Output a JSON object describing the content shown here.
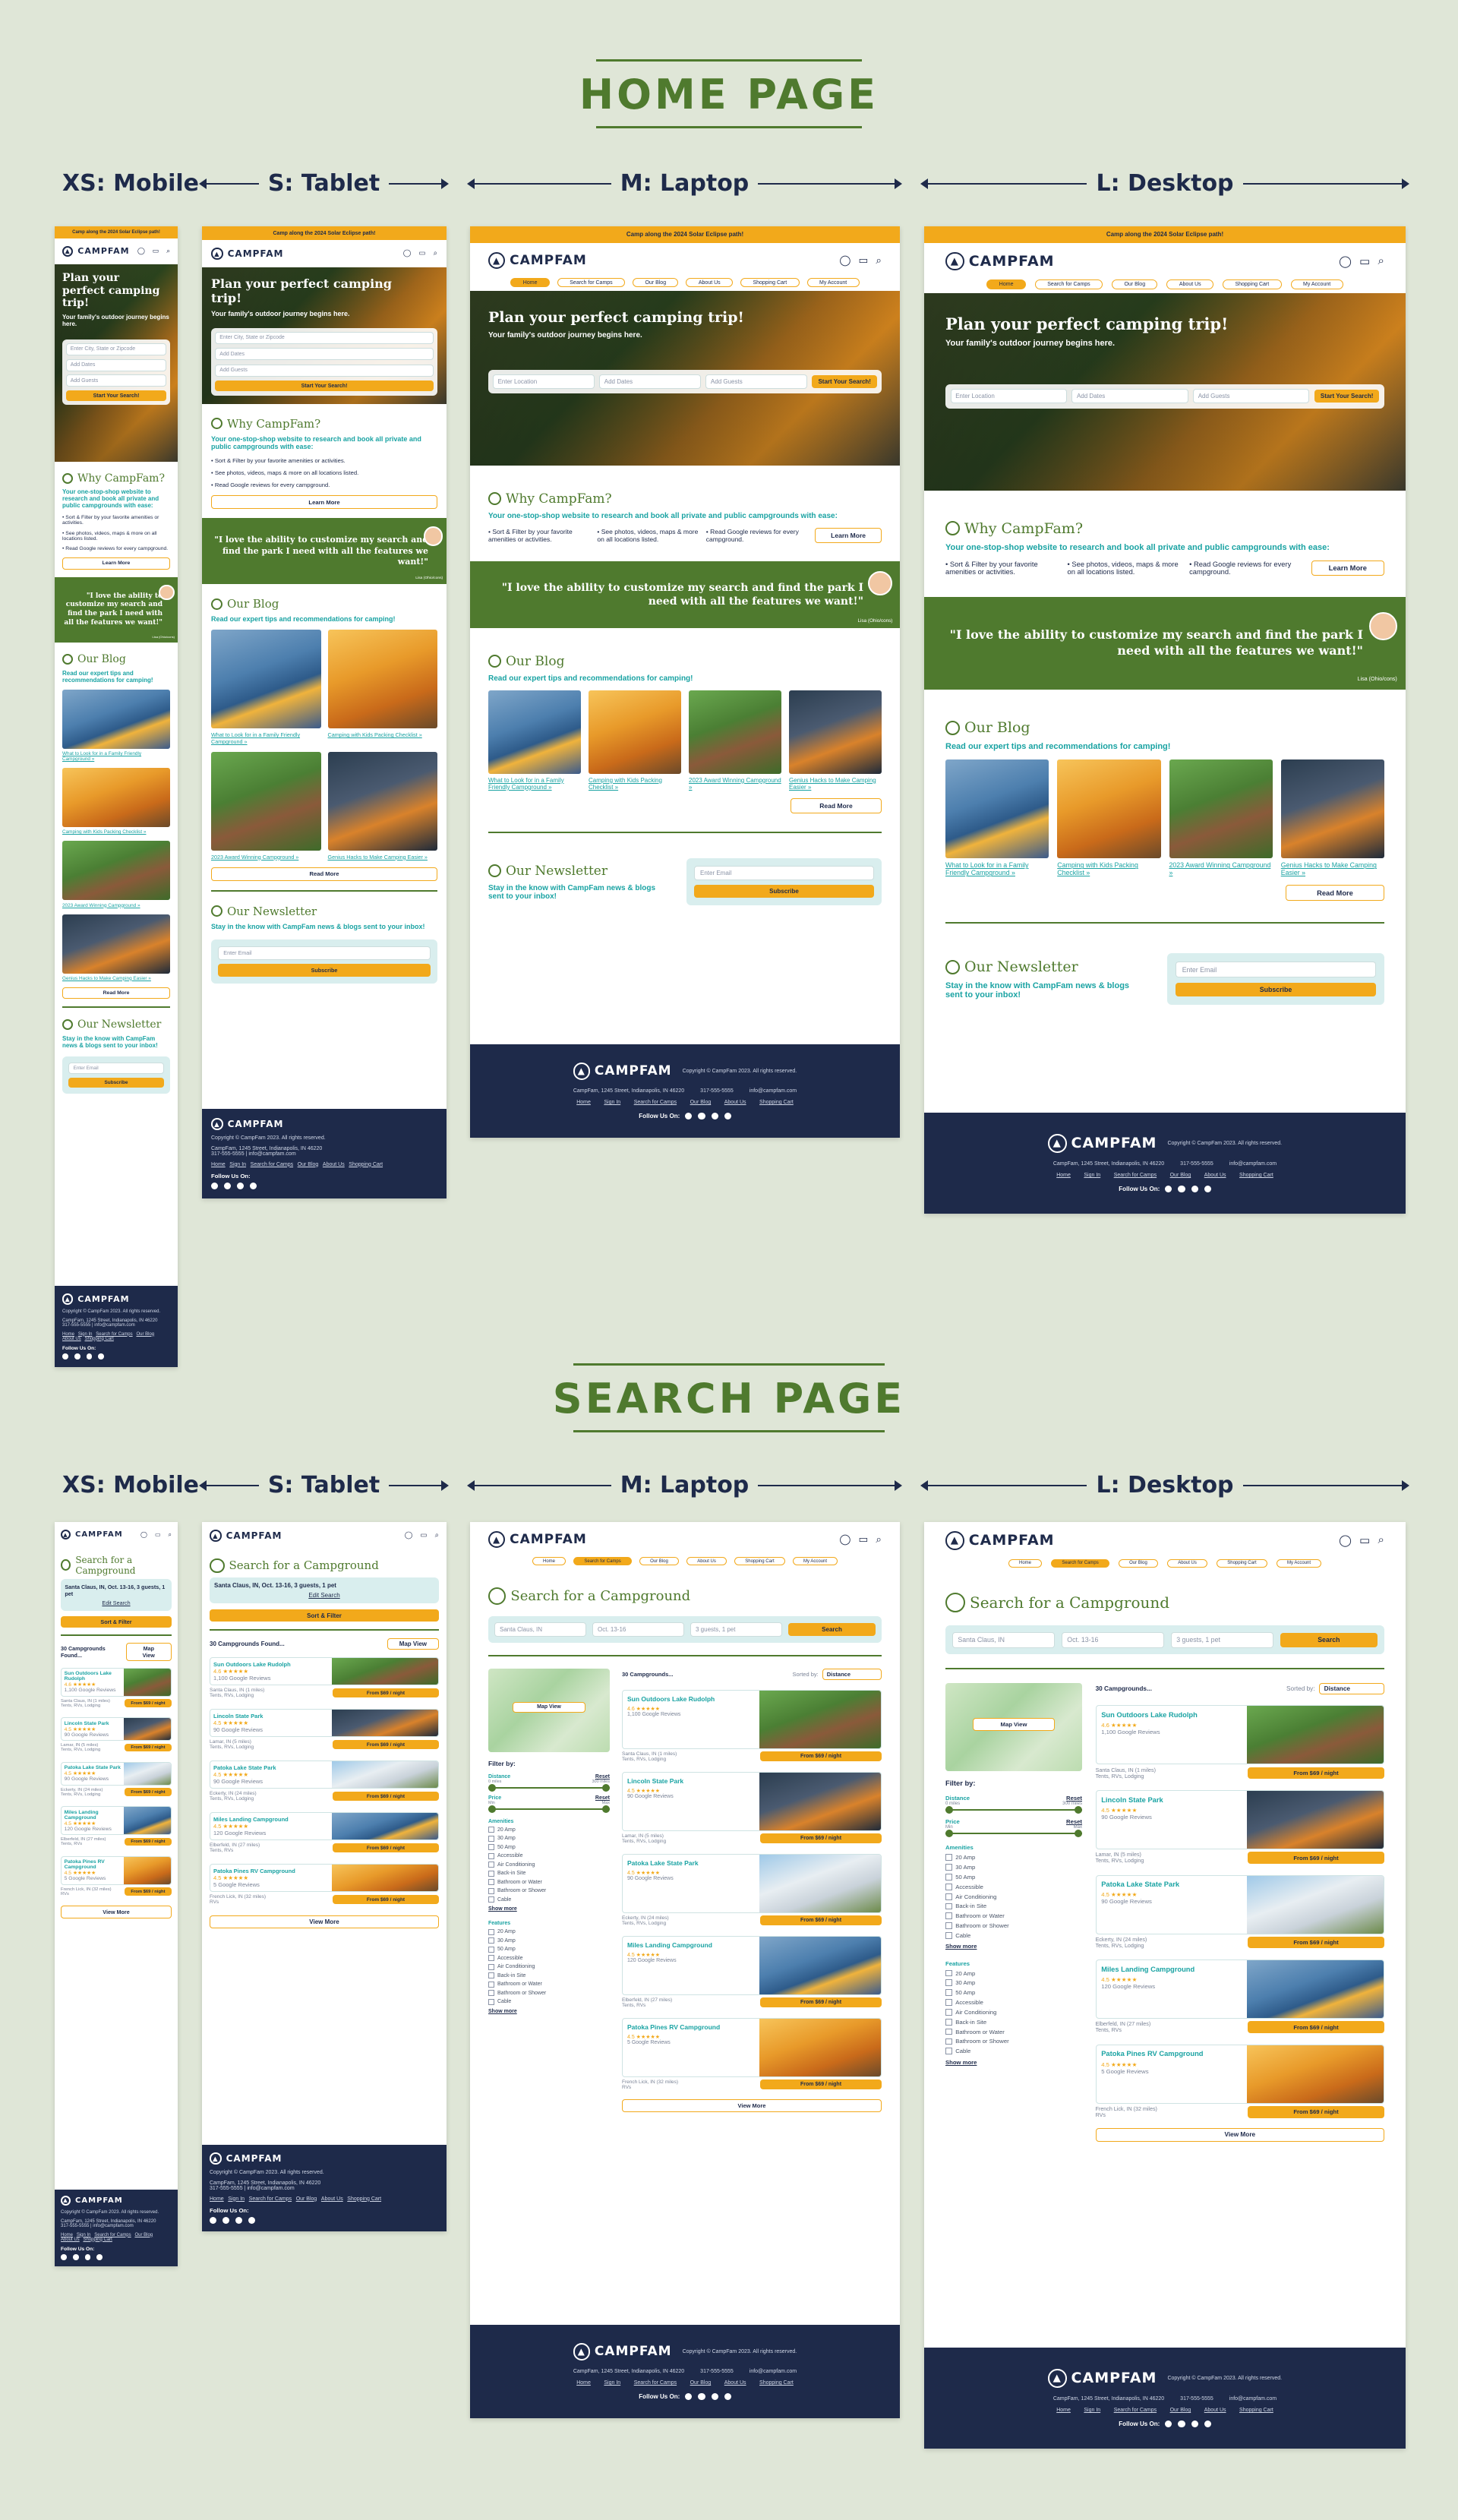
{
  "sections": {
    "home": "HOME PAGE",
    "search": "SEARCH PAGE"
  },
  "viewports": [
    "XS: Mobile",
    "S: Tablet",
    "M: Laptop",
    "L: Desktop"
  ],
  "brand": {
    "name": "CAMPFAM",
    "accent": "#f2a91b",
    "green": "#4f7a2e",
    "teal": "#1aa3a3",
    "navy": "#1e2a4a"
  },
  "banner": "Camp along the 2024 Solar Eclipse path!",
  "nav": [
    "Home",
    "Search for Camps",
    "Our Blog",
    "About Us",
    "Shopping Cart",
    "My Account"
  ],
  "hero": {
    "title": "Plan your perfect camping trip!",
    "subtitle": "Your family's outdoor journey begins here.",
    "location_ph": "Enter Location",
    "location_ph_mobile": "Enter City, State or Zipcode",
    "dates": "Add Dates",
    "guests": "Add Guests",
    "cta": "Start Your Search!"
  },
  "why": {
    "title": "Why CampFam?",
    "sub": "Your one-stop-shop website to research and book all private and public campgrounds with ease:",
    "bullets": [
      "Sort & Filter by your favorite amenities or activities.",
      "See photos, videos, maps & more on all locations listed.",
      "Read Google reviews for every campground."
    ],
    "cta": "Learn More"
  },
  "quote": {
    "text": "\"I love the ability to customize my search and find the park I need with all the features we want!\"",
    "author": "Lisa (Ohio/cons)"
  },
  "blog": {
    "title": "Our Blog",
    "sub": "Read our expert tips and recommendations for camping!",
    "posts": [
      "What to Look for in a Family Friendly Campground »",
      "Camping with Kids Packing Checklist »",
      "2023 Award Winning Campground »",
      "Genius Hacks to Make Camping Easier »"
    ],
    "cta": "Read More"
  },
  "newsletter": {
    "title": "Our Newsletter",
    "sub": "Stay in the know with CampFam news & blogs sent to your inbox!",
    "ph": "Enter Email",
    "cta": "Subscribe"
  },
  "footer": {
    "copy": "Copyright © CampFam 2023. All rights reserved.",
    "address": "CampFam, 1245 Street, Indianapolis, IN 46220",
    "phone": "317-555-5555",
    "email": "info@campfam.com",
    "links": [
      "Home",
      "Sign In",
      "Search for Camps",
      "Our Blog",
      "About Us",
      "Shopping Cart"
    ],
    "follow": "Follow Us On:"
  },
  "search": {
    "title": "Search for a Campground",
    "location": "Santa Claus, IN",
    "dates": "Oct. 13-16",
    "guests": "3 guests, 1 pet",
    "summary_mobile": "Santa Claus, IN, Oct. 13-16, 3 guests, 1 pet",
    "edit": "Edit Search",
    "cta": "Search",
    "sort_filter": "Sort & Filter",
    "count": "30 Campgrounds...",
    "count_small": "30 Campgrounds Found...",
    "sorted_by": "Sorted by:",
    "sort_value": "Distance",
    "map_view": "Map View",
    "filter_by": "Filter by:",
    "distance": "Distance",
    "price": "Price",
    "reset": "Reset",
    "min": "Min",
    "max": "Max",
    "d_min": "0 miles",
    "d_max": "300 miles",
    "amenities_title": "Amenities",
    "amenities": [
      "20 Amp",
      "30 Amp",
      "50 Amp",
      "Accessible",
      "Air Conditioning",
      "Back-in Site",
      "Bathroom or Water",
      "Bathroom or Shower",
      "Cable"
    ],
    "features_title": "Features",
    "features": [
      "20 Amp",
      "30 Amp",
      "50 Amp",
      "Accessible",
      "Air Conditioning",
      "Back-in Site",
      "Bathroom or Water",
      "Bathroom or Shower",
      "Cable"
    ],
    "show_more": "Show more",
    "view_more": "View More",
    "results": [
      {
        "name": "Sun Outdoors Lake Rudolph",
        "rating": "4.6 ★★★★★",
        "reviews": "1,100 Google Reviews",
        "loc": "Santa Claus, IN (1 miles)",
        "type": "Tents, RVs, Lodging",
        "price": "From $69 / night"
      },
      {
        "name": "Lincoln State Park",
        "rating": "4.5 ★★★★★",
        "reviews": "90 Google Reviews",
        "loc": "Lamar, IN (5 miles)",
        "type": "Tents, RVs, Lodging",
        "price": "From $69 / night"
      },
      {
        "name": "Patoka Lake State Park",
        "rating": "4.5 ★★★★★",
        "reviews": "90 Google Reviews",
        "loc": "Eckerty, IN (24 miles)",
        "type": "Tents, RVs, Lodging",
        "price": "From $69 / night"
      },
      {
        "name": "Miles Landing Campground",
        "rating": "4.5 ★★★★★",
        "reviews": "120 Google Reviews",
        "loc": "Elberfeld, IN (27 miles)",
        "type": "Tents, RVs",
        "price": "From $69 / night"
      },
      {
        "name": "Patoka Pines RV Campground",
        "rating": "4.5 ★★★★★",
        "reviews": "5 Google Reviews",
        "loc": "French Lick, IN (32 miles)",
        "type": "RVs",
        "price": "From $69 / night"
      }
    ]
  }
}
